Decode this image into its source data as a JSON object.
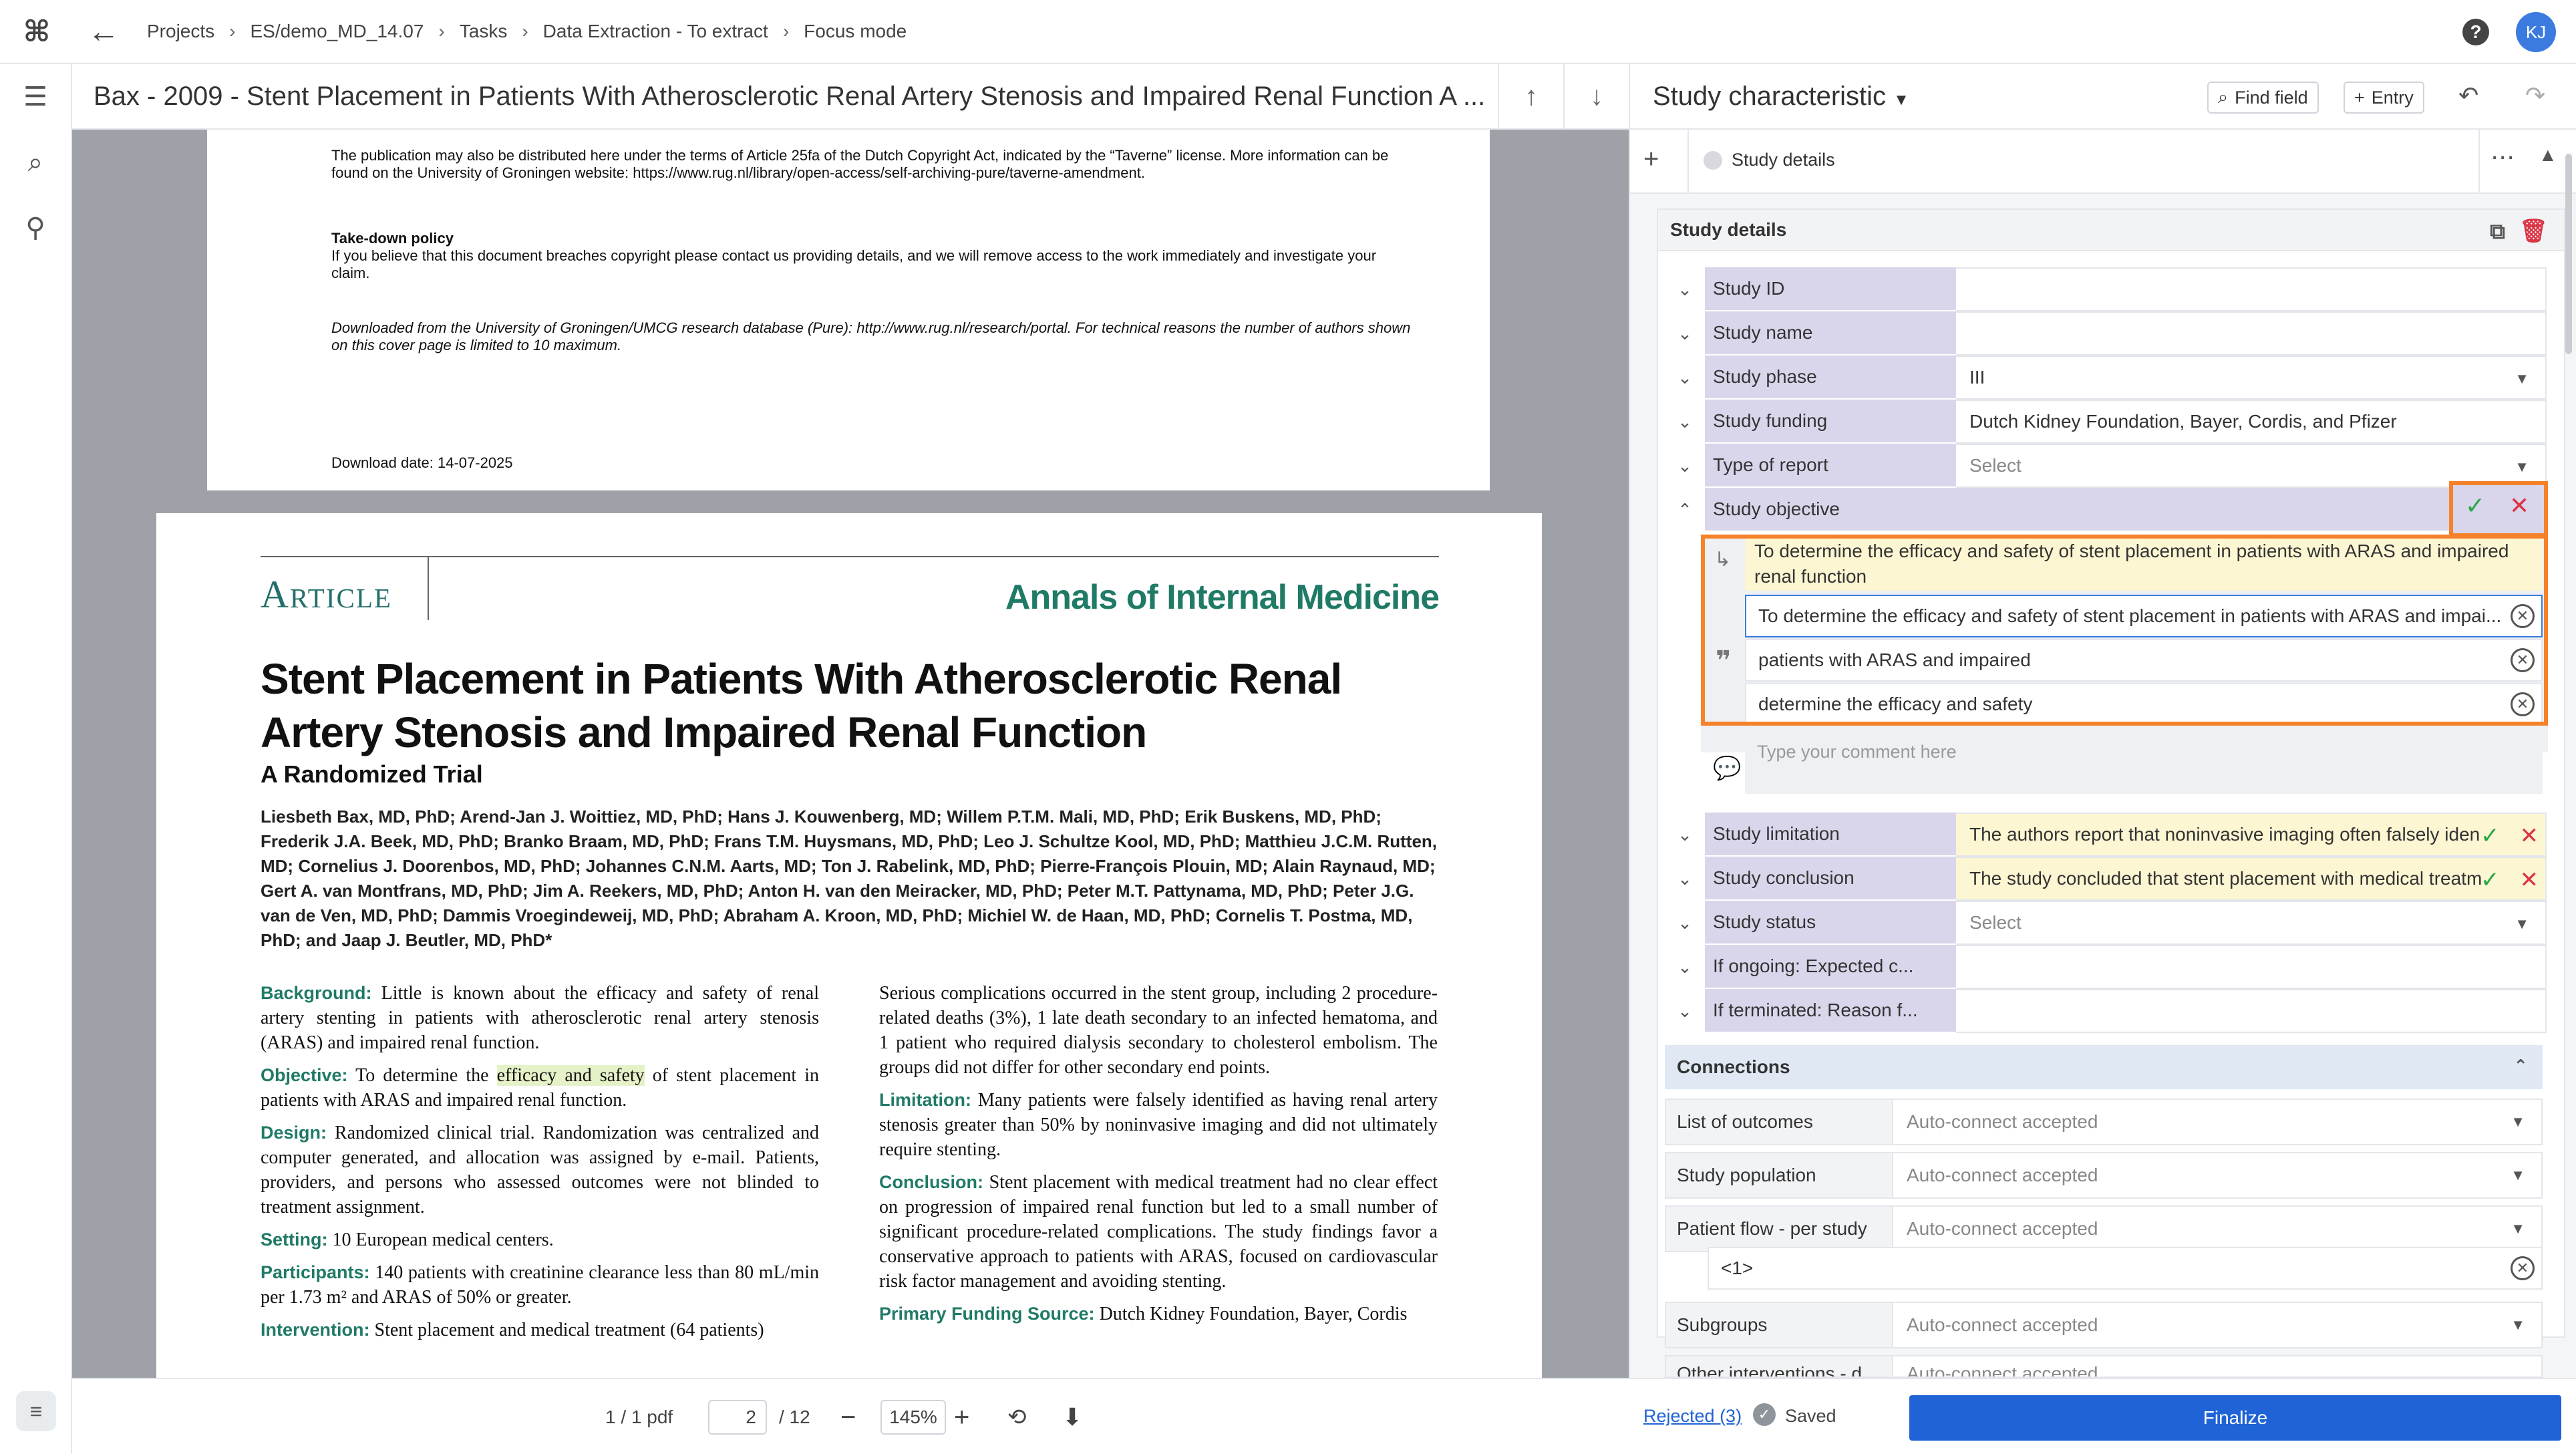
{
  "app": {
    "logo_icon": "logo-icon",
    "breadcrumbs": [
      "Projects",
      "ES/demo_MD_14.07",
      "Tasks",
      "Data Extraction - To extract",
      "Focus mode"
    ],
    "user_initials": "KJ",
    "help_label": "?"
  },
  "document": {
    "title": "Bax - 2009 - Stent Placement in Patients With Atherosclerotic Renal Artery Stenosis and Impaired Renal Function A ...",
    "page1": {
      "para1": "The publication may also be distributed here under the terms of Article 25fa of the Dutch Copyright Act, indicated by the “Taverne” license. More information can be found on the University of Groningen website: https://www.rug.nl/library/open-access/self-archiving-pure/taverne-amendment.",
      "takedown_title": "Take-down policy",
      "takedown_text": "If you believe that this document breaches copyright please contact us providing details, and we will remove access to the work immediately and investigate your claim.",
      "downloaded_from": "Downloaded from the University of Groningen/UMCG research database (Pure): http://www.rug.nl/research/portal. For technical reasons the number of authors shown on this cover page is limited to 10 maximum.",
      "download_date": "Download date: 14-07-2025"
    },
    "page2": {
      "section": "Article",
      "journal": "Annals of Internal Medicine",
      "title": "Stent Placement in Patients With Atherosclerotic Renal Artery Stenosis and Impaired Renal Function",
      "subtitle": "A Randomized Trial",
      "authors": "Liesbeth Bax, MD, PhD; Arend-Jan J. Woittiez, MD, PhD; Hans J. Kouwenberg, MD; Willem P.T.M. Mali, MD, PhD; Erik Buskens, MD, PhD; Frederik J.A. Beek, MD, PhD; Branko Braam, MD, PhD; Frans T.M. Huysmans, MD, PhD; Leo J. Schultze Kool, MD, PhD; Matthieu J.C.M. Rutten, MD; Cornelius J. Doorenbos, MD, PhD; Johannes C.N.M. Aarts, MD; Ton J. Rabelink, MD, PhD; Pierre-François Plouin, MD; Alain Raynaud, MD; Gert A. van Montfrans, MD, PhD; Jim A. Reekers, MD, PhD; Anton H. van den Meiracker, MD, PhD; Peter M.T. Pattynama, MD, PhD; Peter J.G. van de Ven, MD, PhD; Dammis Vroegindeweij, MD, PhD; Abraham A. Kroon, MD, PhD; Michiel W. de Haan, MD, PhD; Cornelis T. Postma, MD, PhD; and Jaap J. Beutler, MD, PhD*",
      "background_h": "Background:",
      "background": "Little is known about the efficacy and safety of renal artery stenting in patients with atherosclerotic renal artery stenosis (ARAS) and impaired renal function.",
      "objective_h": "Objective:",
      "objective_pre": "To determine the",
      "objective_hl": "efficacy and safety",
      "objective_post": "of stent placement in patients with ARAS and impaired renal function.",
      "design_h": "Design:",
      "design": "Randomized clinical trial. Randomization was centralized and computer generated, and allocation was assigned by e-mail. Patients, providers, and persons who assessed outcomes were not blinded to treatment assignment.",
      "setting_h": "Setting:",
      "setting": "10 European medical centers.",
      "participants_h": "Participants:",
      "participants": "140 patients with creatinine clearance less than 80 mL/min per 1.73 m² and ARAS of 50% or greater.",
      "intervention_h": "Intervention:",
      "intervention": "Stent placement and medical treatment (64 patients)",
      "right1": "Serious complications occurred in the stent group, including 2 procedure-related deaths (3%), 1 late death secondary to an infected hematoma, and 1 patient who required dialysis secondary to cholesterol embolism. The groups did not differ for other secondary end points.",
      "limitation_h": "Limitation:",
      "limitation": "Many patients were falsely identified as having renal artery stenosis greater than 50% by noninvasive imaging and did not ultimately require stenting.",
      "conclusion_h": "Conclusion:",
      "conclusion": "Stent placement with medical treatment had no clear effect on progression of impaired renal function but led to a small number of significant procedure-related complications. The study findings favor a conservative approach to patients with ARAS, focused on cardiovascular risk factor management and avoiding stenting.",
      "funding_h": "Primary Funding Source:",
      "funding": "Dutch Kidney Foundation, Bayer, Cordis"
    }
  },
  "doc_footer": {
    "pdf_count": "1 / 1 pdf",
    "page_current": "2",
    "page_total": "/ 12",
    "zoom": "145%"
  },
  "panel": {
    "title": "Study characteristic",
    "find_field": "Find field",
    "entry": "Entry",
    "tab_label": "Study details",
    "card_title": "Study details",
    "fields": [
      {
        "label": "Study ID",
        "value": ""
      },
      {
        "label": "Study name",
        "value": ""
      },
      {
        "label": "Study phase",
        "value": "III"
      },
      {
        "label": "Study funding",
        "value": "Dutch Kidney Foundation, Bayer, Cordis, and Pfizer"
      },
      {
        "label": "Type of report",
        "value": "Select"
      },
      {
        "label": "Study objective",
        "value": ""
      }
    ],
    "objective": {
      "suggestion": "To determine the efficacy and safety of stent placement in patients with ARAS and impaired renal function",
      "value": "To determine the efficacy and safety of stent placement in patients with ARAS and impai...",
      "quotes": [
        "patients with ARAS and impaired",
        "determine the efficacy and safety"
      ],
      "comment_placeholder": "Type your comment here"
    },
    "fields2": [
      {
        "label": "Study limitation",
        "value": "The authors report that noninvasive imaging often falsely iden"
      },
      {
        "label": "Study conclusion",
        "value": "The study concluded that stent placement with medical treatm"
      },
      {
        "label": "Study status",
        "value": "Select"
      },
      {
        "label": "If ongoing: Expected c...",
        "value": ""
      },
      {
        "label": "If terminated: Reason f...",
        "value": ""
      }
    ],
    "connections_title": "Connections",
    "connections": [
      {
        "label": "List of outcomes",
        "value": "Auto-connect accepted"
      },
      {
        "label": "Study population",
        "value": "Auto-connect accepted"
      },
      {
        "label": "Patient flow - per study",
        "value": "Auto-connect accepted"
      },
      {
        "label": "Subgroups",
        "value": "Auto-connect accepted"
      },
      {
        "label": "Other interventions - d...",
        "value": "Auto-connect accepted"
      }
    ],
    "patient_flow_sub": "<1>",
    "rejected": "Rejected (3)",
    "saved": "Saved",
    "finalize": "Finalize"
  },
  "colors": {
    "accent": "#1f63d6",
    "label_bg": "#d9d6ec",
    "highlight_orange": "#f5822a",
    "suggestion_yellow": "#fdf6d3",
    "journal_green": "#1f7a66"
  }
}
